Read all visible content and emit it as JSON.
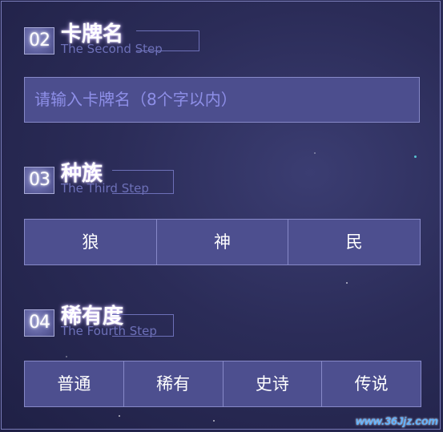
{
  "step_card_name": {
    "number": "02",
    "title": "卡牌名",
    "subtitle": "The Second Step",
    "input_placeholder": "请输入卡牌名（8个字以内）"
  },
  "step_race": {
    "number": "03",
    "title": "种族",
    "subtitle": "The Third Step",
    "options": [
      "狼",
      "神",
      "民"
    ]
  },
  "step_rarity": {
    "number": "04",
    "title": "稀有度",
    "subtitle": "The Fourth Step",
    "options": [
      "普通",
      "稀有",
      "史诗",
      "传说"
    ]
  },
  "watermark": "www.36Jjz.com"
}
